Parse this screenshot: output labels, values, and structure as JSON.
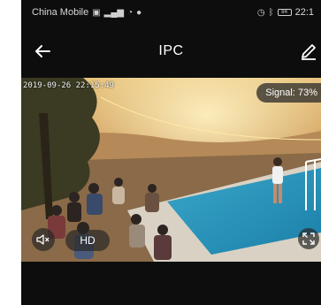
{
  "status_bar": {
    "carrier": "China Mobile",
    "battery": "84",
    "time": "22:1"
  },
  "header": {
    "title": "IPC",
    "back_icon": "arrow-left-icon",
    "edit_icon": "pencil-icon"
  },
  "video": {
    "timestamp": "2019-09-26 22:15:49",
    "signal_text": "Signal: 73%",
    "quality_label": "HD",
    "mute_icon": "speaker-muted-icon",
    "fullscreen_icon": "fullscreen-icon"
  },
  "colors": {
    "background": "#0d0d0d",
    "text": "#ffffff",
    "overlay": "#282828"
  }
}
